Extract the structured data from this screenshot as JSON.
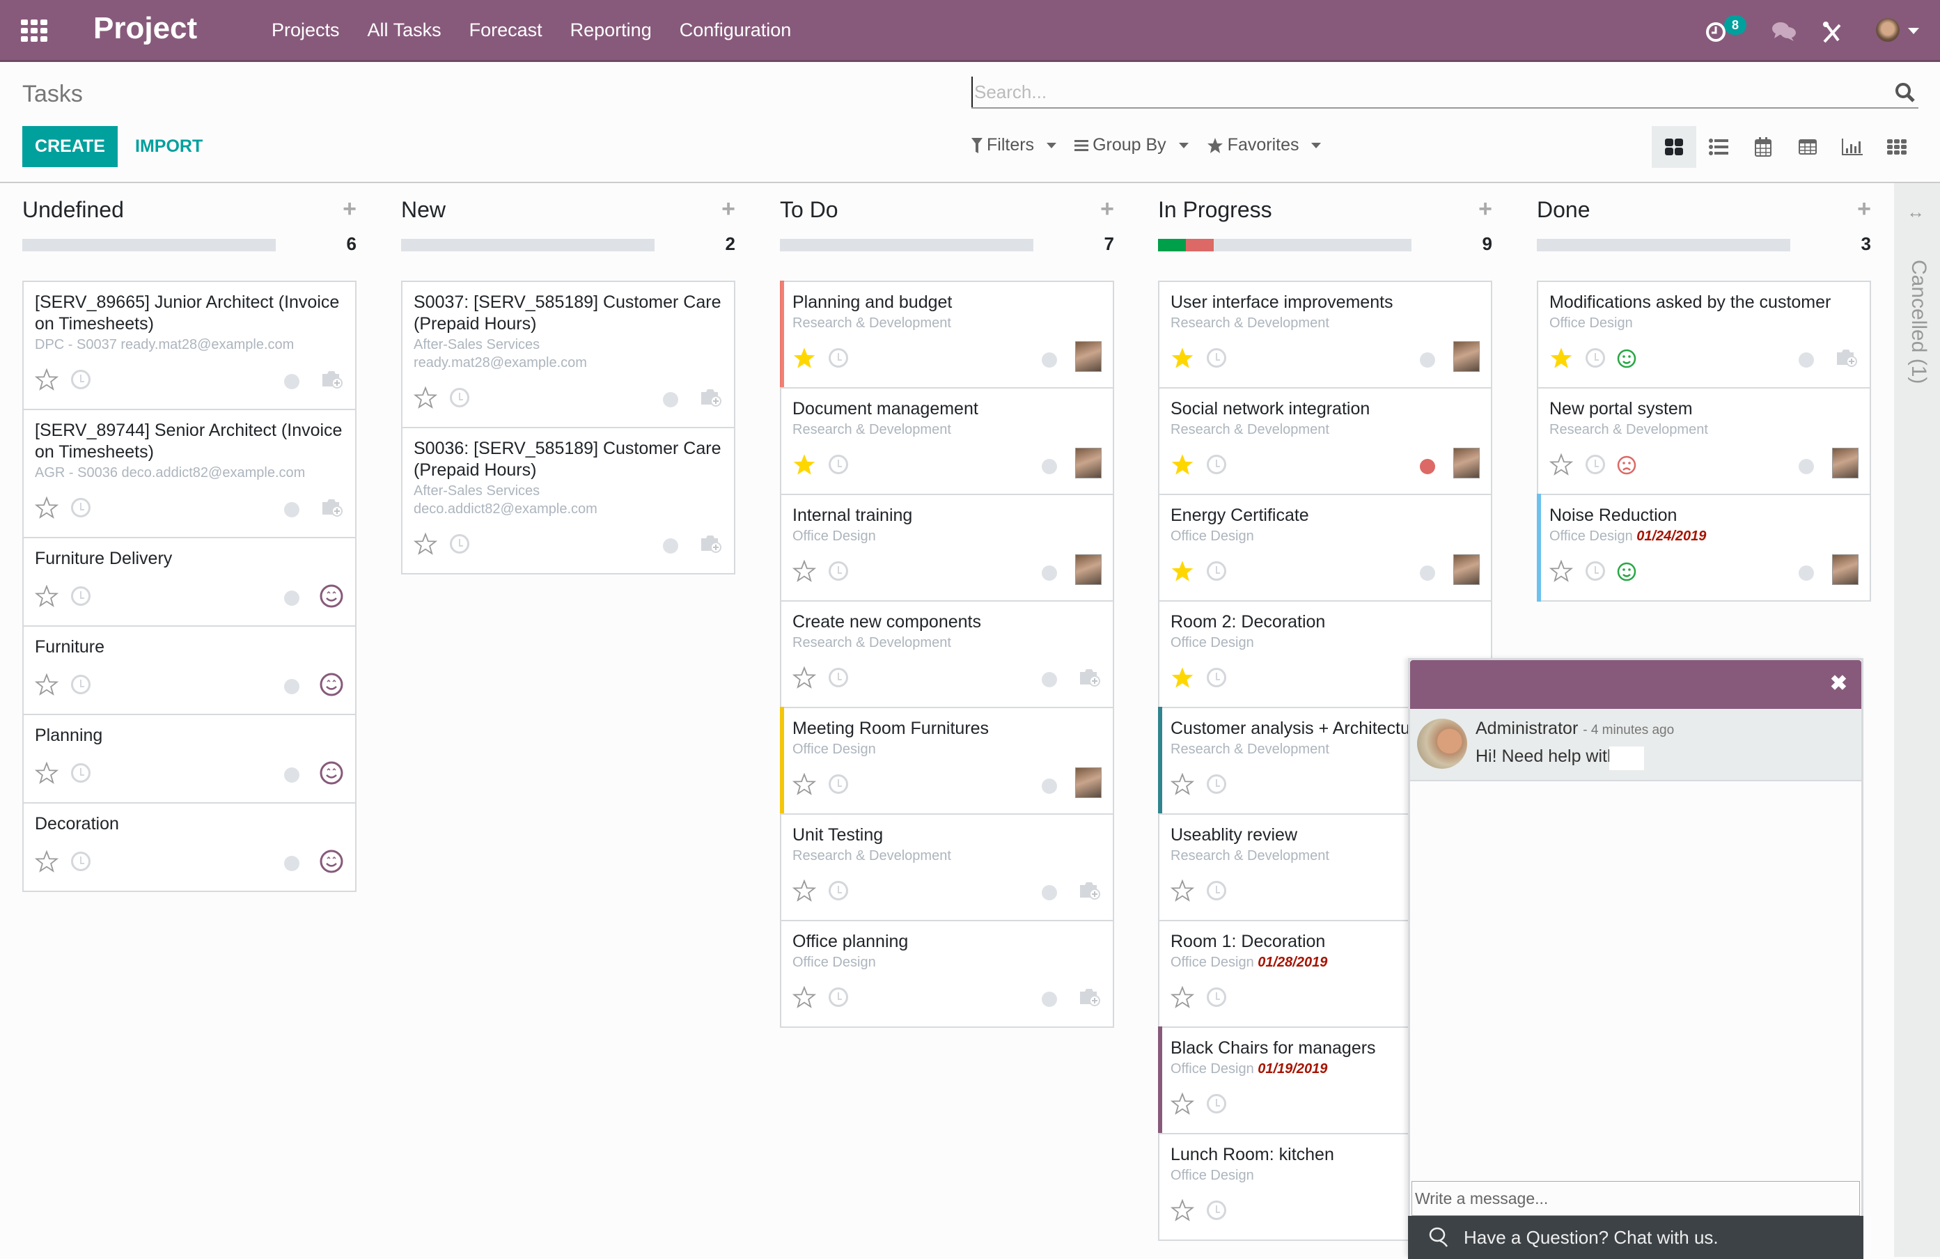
{
  "navbar": {
    "app_name": "Project",
    "menu": [
      "Projects",
      "All Tasks",
      "Forecast",
      "Reporting",
      "Configuration"
    ],
    "activity_badge": "8",
    "icons": [
      "apps-icon",
      "activity-clock-icon",
      "chat-bubbles-icon",
      "tools-icon",
      "user-avatar",
      "caret-down-icon"
    ]
  },
  "control_panel": {
    "title": "Tasks",
    "create_label": "CREATE",
    "import_label": "IMPORT",
    "search_placeholder": "Search...",
    "filters_label": "Filters",
    "groupby_label": "Group By",
    "favorites_label": "Favorites",
    "views": [
      "kanban",
      "list",
      "calendar",
      "pivot",
      "graph",
      "activity"
    ],
    "active_view": "kanban"
  },
  "colors": {
    "brand": "#875a7b",
    "primary": "#00a09d",
    "progress_green": "#00a04a",
    "progress_red": "#dc6965",
    "deadline_red": "#a61300",
    "star_yellow": "#ffd700"
  },
  "columns": [
    {
      "name": "Undefined",
      "count": "6",
      "progress": {
        "green": 0,
        "red": 0
      },
      "cards": [
        {
          "title": "[SERV_89665] Junior Architect (Invoice on Timesheets)",
          "subtitle": "DPC - S0037 ready.mat28@example.com",
          "date": "",
          "starred": false,
          "status": "grey",
          "assignee": "camera",
          "edge": ""
        },
        {
          "title": "[SERV_89744] Senior Architect (Invoice on Timesheets)",
          "subtitle": "AGR - S0036 deco.addict82@example.com",
          "date": "",
          "starred": false,
          "status": "grey",
          "assignee": "camera",
          "edge": ""
        },
        {
          "title": "Furniture Delivery",
          "subtitle": "",
          "date": "",
          "starred": false,
          "status": "grey",
          "assignee": "smile",
          "edge": ""
        },
        {
          "title": "Furniture",
          "subtitle": "",
          "date": "",
          "starred": false,
          "status": "grey",
          "assignee": "smile",
          "edge": ""
        },
        {
          "title": "Planning",
          "subtitle": "",
          "date": "",
          "starred": false,
          "status": "grey",
          "assignee": "smile",
          "edge": ""
        },
        {
          "title": "Decoration",
          "subtitle": "",
          "date": "",
          "starred": false,
          "status": "grey",
          "assignee": "smile",
          "edge": ""
        }
      ]
    },
    {
      "name": "New",
      "count": "2",
      "progress": {
        "green": 0,
        "red": 0
      },
      "cards": [
        {
          "title": "S0037: [SERV_585189] Customer Care (Prepaid Hours)",
          "subtitle": "After-Sales Services",
          "subtitle2": "ready.mat28@example.com",
          "date": "",
          "starred": false,
          "status": "grey",
          "assignee": "camera",
          "edge": ""
        },
        {
          "title": "S0036: [SERV_585189] Customer Care (Prepaid Hours)",
          "subtitle": "After-Sales Services",
          "subtitle2": "deco.addict82@example.com",
          "date": "",
          "starred": false,
          "status": "grey",
          "assignee": "camera",
          "edge": ""
        }
      ]
    },
    {
      "name": "To Do",
      "count": "7",
      "progress": {
        "green": 0,
        "red": 0
      },
      "cards": [
        {
          "title": "Planning and budget",
          "subtitle": "Research & Development",
          "date": "",
          "starred": true,
          "status": "grey",
          "assignee": "photo",
          "edge": "red"
        },
        {
          "title": "Document management",
          "subtitle": "Research & Development",
          "date": "",
          "starred": true,
          "status": "grey",
          "assignee": "photo",
          "edge": ""
        },
        {
          "title": "Internal training",
          "subtitle": "Office Design",
          "date": "",
          "starred": false,
          "status": "grey",
          "assignee": "photo",
          "edge": ""
        },
        {
          "title": "Create new components",
          "subtitle": "Research & Development",
          "date": "",
          "starred": false,
          "status": "grey",
          "assignee": "camera",
          "edge": ""
        },
        {
          "title": "Meeting Room Furnitures",
          "subtitle": "Office Design",
          "date": "",
          "starred": false,
          "status": "grey",
          "assignee": "photo",
          "edge": "yellow"
        },
        {
          "title": "Unit Testing",
          "subtitle": "Research & Development",
          "date": "",
          "starred": false,
          "status": "grey",
          "assignee": "camera",
          "edge": ""
        },
        {
          "title": "Office planning",
          "subtitle": "Office Design",
          "date": "",
          "starred": false,
          "status": "grey",
          "assignee": "camera",
          "edge": ""
        }
      ]
    },
    {
      "name": "In Progress",
      "count": "9",
      "progress": {
        "green": 0.11,
        "red": 0.11
      },
      "cards": [
        {
          "title": "User interface improvements",
          "subtitle": "Research & Development",
          "date": "",
          "starred": true,
          "status": "grey",
          "assignee": "photo",
          "edge": ""
        },
        {
          "title": "Social network integration",
          "subtitle": "Research & Development",
          "date": "",
          "starred": true,
          "status": "red",
          "assignee": "photo",
          "edge": ""
        },
        {
          "title": "Energy Certificate",
          "subtitle": "Office Design",
          "date": "",
          "starred": true,
          "status": "grey",
          "assignee": "photo",
          "edge": ""
        },
        {
          "title": "Room 2: Decoration",
          "subtitle": "Office Design",
          "date": "",
          "starred": true,
          "status": "grey",
          "assignee": "photo",
          "edge": ""
        },
        {
          "title": "Customer analysis + Architecture",
          "subtitle": "Research & Development",
          "date": "",
          "starred": false,
          "status": "",
          "assignee": "",
          "edge": "teal"
        },
        {
          "title": "Useablity review",
          "subtitle": "Research & Development",
          "date": "",
          "starred": false,
          "status": "",
          "assignee": "",
          "edge": ""
        },
        {
          "title": "Room 1: Decoration",
          "subtitle": "Office Design",
          "date": "01/28/2019",
          "starred": false,
          "status": "",
          "assignee": "",
          "edge": ""
        },
        {
          "title": "Black Chairs for managers",
          "subtitle": "Office Design",
          "date": "01/19/2019",
          "starred": false,
          "status": "",
          "assignee": "",
          "edge": "purple"
        },
        {
          "title": "Lunch Room: kitchen",
          "subtitle": "Office Design",
          "date": "",
          "starred": false,
          "status": "",
          "assignee": "",
          "edge": ""
        }
      ]
    },
    {
      "name": "Done",
      "count": "3",
      "progress": {
        "green": 0,
        "red": 0
      },
      "cards": [
        {
          "title": "Modifications asked by the customer",
          "subtitle": "Office Design",
          "date": "",
          "starred": true,
          "status": "grey",
          "assignee": "camera",
          "edge": "",
          "rating": "happy"
        },
        {
          "title": "New portal system",
          "subtitle": "Research & Development",
          "date": "",
          "starred": false,
          "status": "grey",
          "assignee": "photo",
          "edge": "",
          "rating": "sad"
        },
        {
          "title": "Noise Reduction",
          "subtitle": "Office Design",
          "date": "01/24/2019",
          "starred": false,
          "status": "grey",
          "assignee": "photo",
          "edge": "blue",
          "rating": "happy"
        }
      ]
    }
  ],
  "folded_column": {
    "label": "Cancelled (1)"
  },
  "chat": {
    "author": "Administrator",
    "time": "- 4 minutes ago",
    "message": "Hi! Need help with C",
    "input_placeholder": "Write a message...",
    "banner": "Have a Question? Chat with us."
  }
}
